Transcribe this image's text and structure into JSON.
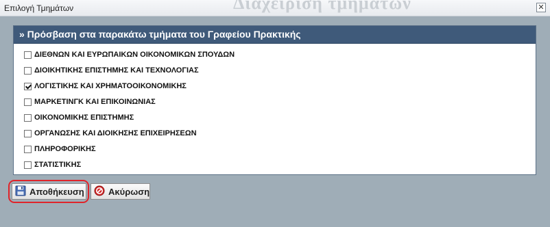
{
  "window": {
    "title": "Επιλογή Τμημάτων",
    "background_heading": "Διαχείριση τμημάτων"
  },
  "panel": {
    "header": "» Πρόσβαση στα παρακάτω τμήματα του Γραφείου Πρακτικής",
    "departments": [
      {
        "label": "ΔΙΕΘΝΩΝ ΚΑΙ ΕΥΡΩΠΑΙΚΩΝ ΟΙΚΟΝΟΜΙΚΩΝ ΣΠΟΥΔΩΝ",
        "checked": false
      },
      {
        "label": "ΔΙΟΙΚΗΤΙΚΗΣ ΕΠΙΣΤΗΜΗΣ ΚΑΙ ΤΕΧΝΟΛΟΓΙΑΣ",
        "checked": false
      },
      {
        "label": "ΛΟΓΙΣΤΙΚΗΣ ΚΑΙ ΧΡΗΜΑΤΟΟΙΚΟΝΟΜΙΚΗΣ",
        "checked": true
      },
      {
        "label": "ΜΑΡΚΕΤΙΝΓΚ ΚΑΙ ΕΠΙΚΟΙΝΩΝΙΑΣ",
        "checked": false
      },
      {
        "label": "ΟΙΚΟΝΟΜΙΚΗΣ ΕΠΙΣΤΗΜΗΣ",
        "checked": false
      },
      {
        "label": "ΟΡΓΑΝΩΣΗΣ ΚΑΙ ΔΙΟΙΚΗΣΗΣ ΕΠΙΧΕΙΡΗΣΕΩΝ",
        "checked": false
      },
      {
        "label": "ΠΛΗΡΟΦΟΡΙΚΗΣ",
        "checked": false
      },
      {
        "label": "ΣΤΑΤΙΣΤΙΚΗΣ",
        "checked": false
      }
    ]
  },
  "buttons": {
    "save_label": "Αποθήκευση",
    "cancel_label": "Ακύρωση",
    "save_icon": "floppy-disk-icon",
    "cancel_icon": "cancel-icon"
  },
  "colors": {
    "header_bg": "#3f5a7a",
    "page_bg": "#9fadb7",
    "highlight": "#e0242a"
  }
}
